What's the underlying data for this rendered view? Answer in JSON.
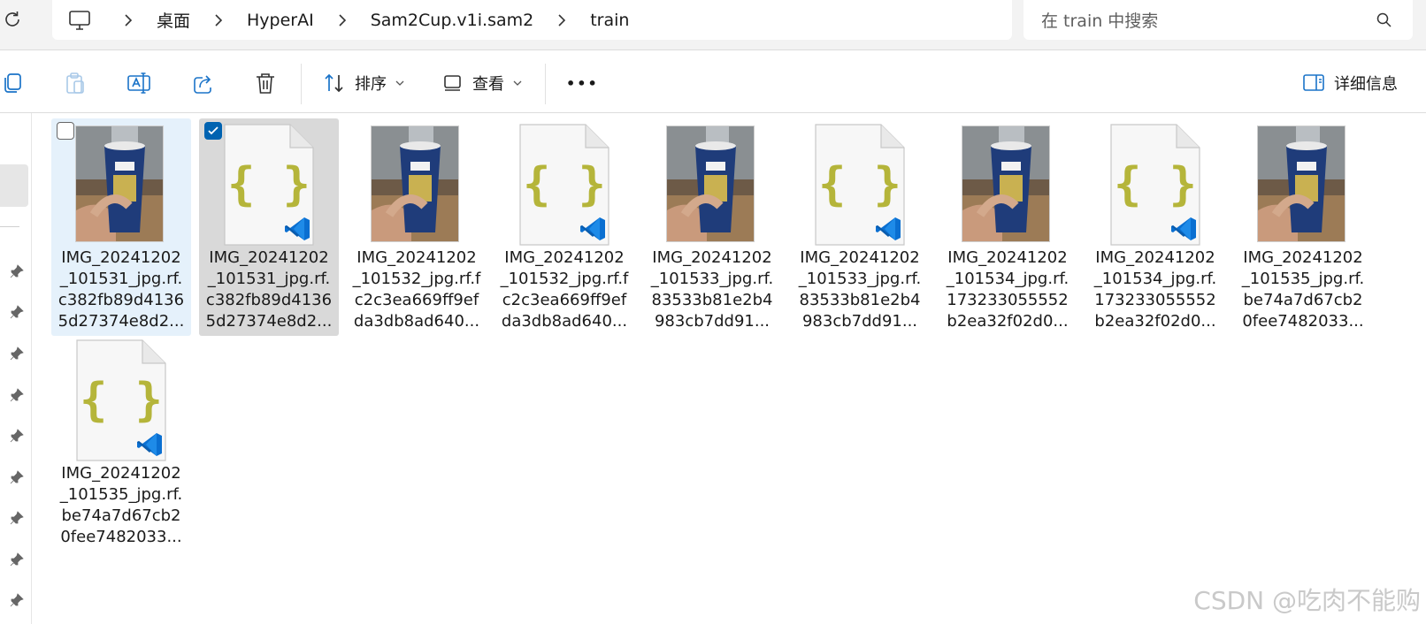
{
  "breadcrumb": {
    "items": [
      "桌面",
      "HyperAI",
      "Sam2Cup.v1i.sam2",
      "train"
    ]
  },
  "search": {
    "placeholder": "在 train 中搜索"
  },
  "toolbar": {
    "sort_label": "排序",
    "view_label": "查看",
    "more_label": "•••",
    "details_label": "详细信息"
  },
  "files": [
    {
      "name_lines": [
        "IMG_20241202",
        "_101531_jpg.rf.",
        "c382fb89d4136",
        "5d27374e8d2..."
      ],
      "kind": "photo",
      "state": "hover",
      "checked": false
    },
    {
      "name_lines": [
        "IMG_20241202",
        "_101531_jpg.rf.",
        "c382fb89d4136",
        "5d27374e8d2..."
      ],
      "kind": "json",
      "state": "selected",
      "checked": true
    },
    {
      "name_lines": [
        "IMG_20241202",
        "_101532_jpg.rf.f",
        "c2c3ea669ff9ef",
        "da3db8ad640..."
      ],
      "kind": "photo",
      "state": "normal",
      "checked": false
    },
    {
      "name_lines": [
        "IMG_20241202",
        "_101532_jpg.rf.f",
        "c2c3ea669ff9ef",
        "da3db8ad640..."
      ],
      "kind": "json",
      "state": "normal",
      "checked": false
    },
    {
      "name_lines": [
        "IMG_20241202",
        "_101533_jpg.rf.",
        "83533b81e2b4",
        "983cb7dd91..."
      ],
      "kind": "photo",
      "state": "normal",
      "checked": false
    },
    {
      "name_lines": [
        "IMG_20241202",
        "_101533_jpg.rf.",
        "83533b81e2b4",
        "983cb7dd91..."
      ],
      "kind": "json",
      "state": "normal",
      "checked": false
    },
    {
      "name_lines": [
        "IMG_20241202",
        "_101534_jpg.rf.",
        "173233055552",
        "b2ea32f02d0..."
      ],
      "kind": "photo",
      "state": "normal",
      "checked": false
    },
    {
      "name_lines": [
        "IMG_20241202",
        "_101534_jpg.rf.",
        "173233055552",
        "b2ea32f02d0..."
      ],
      "kind": "json",
      "state": "normal",
      "checked": false
    },
    {
      "name_lines": [
        "IMG_20241202",
        "_101535_jpg.rf.",
        "be74a7d67cb2",
        "0fee7482033..."
      ],
      "kind": "photo",
      "state": "normal",
      "checked": false
    },
    {
      "name_lines": [
        "IMG_20241202",
        "_101535_jpg.rf.",
        "be74a7d67cb2",
        "0fee7482033..."
      ],
      "kind": "json",
      "state": "normal",
      "checked": false
    }
  ],
  "icons": {
    "json_brace_color": "#b5b53a",
    "vscode_color": "#0a6fd1",
    "checkbox_color": "#0063b1"
  },
  "watermark": "CSDN @吃肉不能购"
}
